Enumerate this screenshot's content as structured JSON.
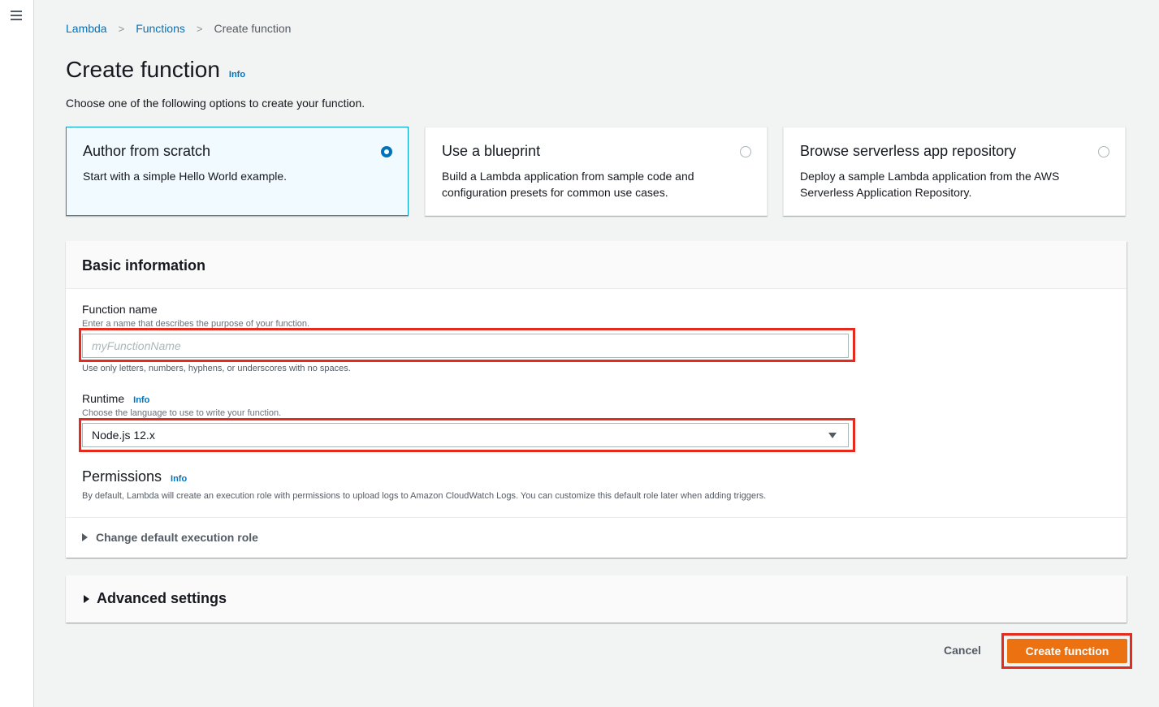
{
  "nav": {
    "menu_icon": "hamburger-icon"
  },
  "breadcrumb": {
    "items": [
      "Lambda",
      "Functions",
      "Create function"
    ],
    "separator": ">"
  },
  "page": {
    "title": "Create function",
    "info": "Info",
    "subtitle": "Choose one of the following options to create your function."
  },
  "options": [
    {
      "title": "Author from scratch",
      "desc": "Start with a simple Hello World example.",
      "selected": true
    },
    {
      "title": "Use a blueprint",
      "desc": "Build a Lambda application from sample code and configuration presets for common use cases.",
      "selected": false
    },
    {
      "title": "Browse serverless app repository",
      "desc": "Deploy a sample Lambda application from the AWS Serverless Application Repository.",
      "selected": false
    }
  ],
  "basic": {
    "header": "Basic information",
    "function_name": {
      "label": "Function name",
      "desc": "Enter a name that describes the purpose of your function.",
      "placeholder": "myFunctionName",
      "hint": "Use only letters, numbers, hyphens, or underscores with no spaces."
    },
    "runtime": {
      "label": "Runtime",
      "info": "Info",
      "desc": "Choose the language to use to write your function.",
      "value": "Node.js 12.x"
    },
    "permissions": {
      "title": "Permissions",
      "info": "Info",
      "desc": "By default, Lambda will create an execution role with permissions to upload logs to Amazon CloudWatch Logs. You can customize this default role later when adding triggers.",
      "expander": "Change default execution role"
    }
  },
  "advanced": {
    "label": "Advanced settings"
  },
  "actions": {
    "cancel": "Cancel",
    "create": "Create function"
  },
  "colors": {
    "accent": "#0073bb",
    "primary_button": "#ec7211",
    "highlight": "#e52b1e"
  }
}
